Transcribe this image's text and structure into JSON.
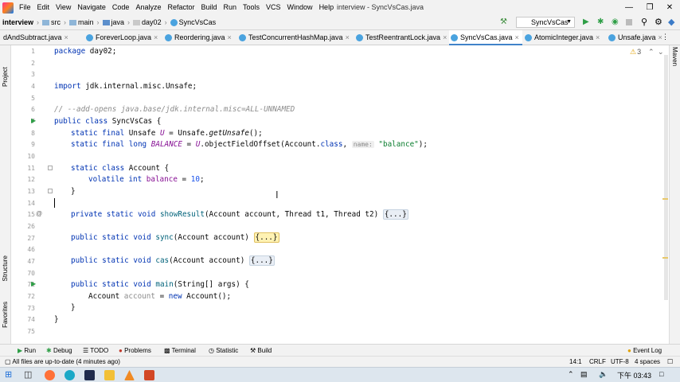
{
  "menubar": {
    "items": [
      "File",
      "Edit",
      "View",
      "Navigate",
      "Code",
      "Analyze",
      "Refactor",
      "Build",
      "Run",
      "Tools",
      "VCS",
      "Window",
      "Help"
    ],
    "window_title": "interview - SyncVsCas.java"
  },
  "navbar": {
    "crumbs": [
      "interview",
      "src",
      "main",
      "java",
      "day02",
      "SyncVsCas"
    ],
    "run_config": "SyncVsCas"
  },
  "tabs": [
    {
      "label": "dAndSubtract.java",
      "active": false
    },
    {
      "label": "ForeverLoop.java",
      "active": false
    },
    {
      "label": "Reordering.java",
      "active": false
    },
    {
      "label": "TestConcurrentHashMap.java",
      "active": false
    },
    {
      "label": "TestReentrantLock.java",
      "active": false
    },
    {
      "label": "SyncVsCas.java",
      "active": true
    },
    {
      "label": "AtomicInteger.java",
      "active": false
    },
    {
      "label": "Unsafe.java",
      "active": false
    }
  ],
  "side_tools": {
    "left_top": "Project",
    "left_mid": "Structure",
    "left_bottom": "Favorites",
    "right": "Maven"
  },
  "editor": {
    "warnings_count": "3",
    "line_numbers": [
      "1",
      "2",
      "3",
      "4",
      "5",
      "6",
      "7",
      "8",
      "9",
      "10",
      "11",
      "12",
      "13",
      "14",
      "15",
      "26",
      "27",
      "46",
      "47",
      "70",
      "71",
      "72",
      "73",
      "74",
      "75"
    ],
    "lines": {
      "l1": {
        "kw": "package",
        "rest": " day02;"
      },
      "l4": {
        "kw": "import",
        "rest": " jdk.internal.misc.Unsafe;"
      },
      "l6": "// --add-opens java.base/jdk.internal.misc=ALL-UNNAMED",
      "l7": {
        "kw": "public class",
        "rest": " SyncVsCas {"
      },
      "l8": {
        "kw": "static final",
        "type": " Unsafe ",
        "const": "U",
        "eq": " = Unsafe.",
        "mth": "getUnsafe",
        "tail": "();"
      },
      "l9": {
        "kw": "static final long",
        "const": " BALANCE",
        "eq": " = ",
        "const2": "U",
        "mid": ".objectFieldOffset(Account.",
        "kw2": "class",
        "comma": ",",
        "hint": "name:",
        "str": "\"balance\"",
        "tail": ");"
      },
      "l11": {
        "kw": "static class",
        "rest": " Account {"
      },
      "l12": {
        "kw": "volatile int",
        "field": " balance",
        "eq": " = ",
        "num": "10",
        "tail": ";"
      },
      "l13": "}",
      "l15": {
        "kw": "private static void",
        "name": " showResult",
        "rest": "(Account account, Thread t1, Thread t2) ",
        "fold": "{...}"
      },
      "l27": {
        "kw": "public static void",
        "name": " sync",
        "rest": "(Account account) ",
        "fold": "{...}"
      },
      "l47": {
        "kw": "public static void",
        "name": " cas",
        "rest": "(Account account) ",
        "fold": "{...}"
      },
      "l71": {
        "kw": "public static void",
        "name": " main",
        "rest": "(String[] args) {"
      },
      "l72": {
        "type": "Account ",
        "var": "account",
        "eq": " = ",
        "kw": "new",
        "tail": " Account();"
      },
      "l73": "}",
      "l74": "}"
    }
  },
  "toolwindows": [
    "Run",
    "Debug",
    "TODO",
    "Problems",
    "Terminal",
    "Statistic",
    "Build"
  ],
  "event_log": "Event Log",
  "status": {
    "message": "All files are up-to-date (4 minutes ago)",
    "position": "14:1",
    "line_sep": "CRLF",
    "encoding": "UTF-8",
    "indent": "4 spaces"
  },
  "taskbar": {
    "clock": "下午 03:43"
  },
  "colors": {
    "keyword": "#0033b3",
    "comment": "#8c8c8c",
    "string": "#0a7d2e",
    "number": "#1750eb",
    "constant": "#871094",
    "accent": "#4083c9"
  }
}
